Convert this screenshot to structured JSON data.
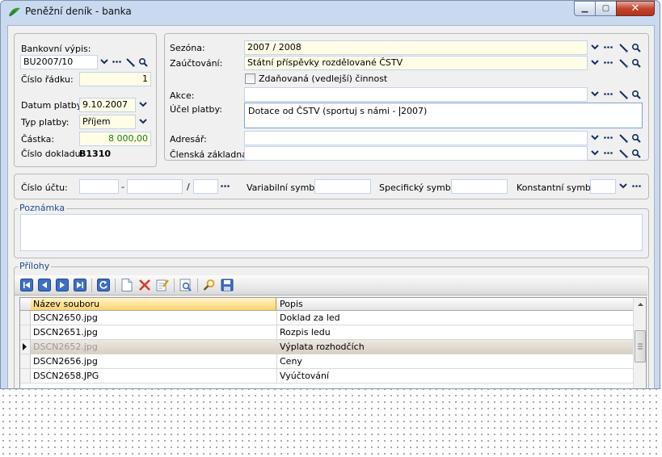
{
  "window": {
    "title": "Peněžní deník - banka",
    "close_glyph": "✕",
    "min_glyph": "▁",
    "max_glyph": "▢"
  },
  "left_panel": {
    "bank_statement_label": "Bankovní výpis:",
    "bank_statement_value": "BU2007/10",
    "row_number_label": "Číslo řádku:",
    "row_number_value": "1",
    "payment_date_label": "Datum platby:",
    "payment_date_value": "9.10.2007",
    "payment_type_label": "Typ platby:",
    "payment_type_value": "Příjem",
    "amount_label": "Částka:",
    "amount_value": "8 000,00",
    "document_number_label": "Číslo dokladu:",
    "document_number_value": "B1310"
  },
  "right_panel": {
    "season_label": "Sezóna:",
    "season_value": "2007 / 2008",
    "accounting_label": "Zaúčtování:",
    "accounting_value": "Státní příspěvky rozdělované ČSTV",
    "taxed_label": "Zdaňovaná (vedlejší) činnost",
    "taxed_checked": false,
    "action_label": "Akce:",
    "action_value": "",
    "purpose_label": "Účel platby:",
    "purpose_text_before": "Dotace od ČSTV (sportuj s námi - ",
    "purpose_text_after": "2007)",
    "address_label": "Adresář:",
    "address_value": "",
    "membership_label": "Členská základna:",
    "membership_value": ""
  },
  "account_panel": {
    "account_label": "Číslo účtu:",
    "dash": "-",
    "slash": "/",
    "variable_label": "Variabilní symbol:",
    "specific_label": "Specifický symbol:",
    "constant_label": "Konstantní symbol:"
  },
  "note": {
    "title": "Poznámka",
    "value": ""
  },
  "attachments": {
    "title": "Přílohy",
    "columns": [
      "Název souboru",
      "Popis"
    ],
    "rows": [
      {
        "file": "DSCN2650.jpg",
        "desc": "Doklad za led"
      },
      {
        "file": "DSCN2651.jpg",
        "desc": "Rozpis ledu"
      },
      {
        "file": "DSCN2652.jpg",
        "desc": "Výplata rozhodčích"
      },
      {
        "file": "DSCN2656.jpg",
        "desc": "Ceny"
      },
      {
        "file": "DSCN2658.JPG",
        "desc": "Vyúčtování"
      }
    ],
    "current_row_index": 2
  },
  "icons": {
    "app": "money-leaf-icon",
    "dropdown": "chevron-down-icon",
    "ellipsis": "ellipsis-icon",
    "pencil": "pencil-icon",
    "search": "magnifier-icon"
  },
  "colors": {
    "window_frame": "#c9daf0",
    "field_yellow": "#fffde6",
    "header_highlight": "#fcd36b",
    "group_title": "#1f4a8c"
  }
}
